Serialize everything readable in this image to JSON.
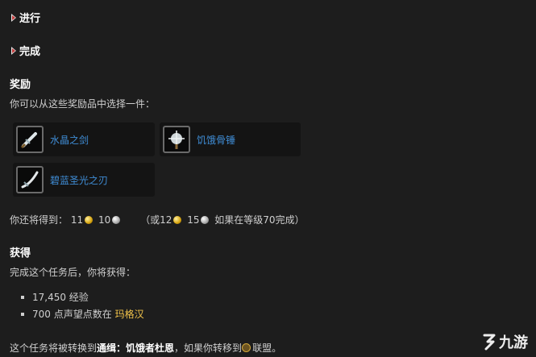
{
  "sections": {
    "progress": "进行",
    "complete": "完成"
  },
  "rewards": {
    "heading": "奖励",
    "choose_text": "你可以从这些奖励品中选择一件：",
    "items": [
      {
        "name": "水晶之剑",
        "icon": "sword-icon"
      },
      {
        "name": "饥饿骨锤",
        "icon": "mace-icon"
      },
      {
        "name": "碧蓝圣光之刃",
        "icon": "blade-icon"
      }
    ],
    "money": {
      "prefix": "你还将得到：",
      "gold": "11",
      "silver": "10",
      "alt_open": "（或",
      "alt_gold": "12",
      "alt_silver": "15",
      "alt_suffix": "如果在等级70完成）"
    }
  },
  "gains": {
    "heading": "获得",
    "intro": "完成这个任务后，你将获得：",
    "xp": "17,450 经验",
    "rep_prefix": "700 点声望点数在",
    "rep_faction": "玛格汉"
  },
  "footer": {
    "text_1": "这个任务将被转换到",
    "label": "通缉：",
    "quest": "饥饿者杜恩",
    "text_2": "，如果你转移到",
    "faction": "联盟",
    "end": "。"
  },
  "watermark": {
    "text": "九游"
  },
  "colors": {
    "background": "#1d1d1d",
    "link": "#3f8dd6",
    "faction": "#f0c24a"
  }
}
